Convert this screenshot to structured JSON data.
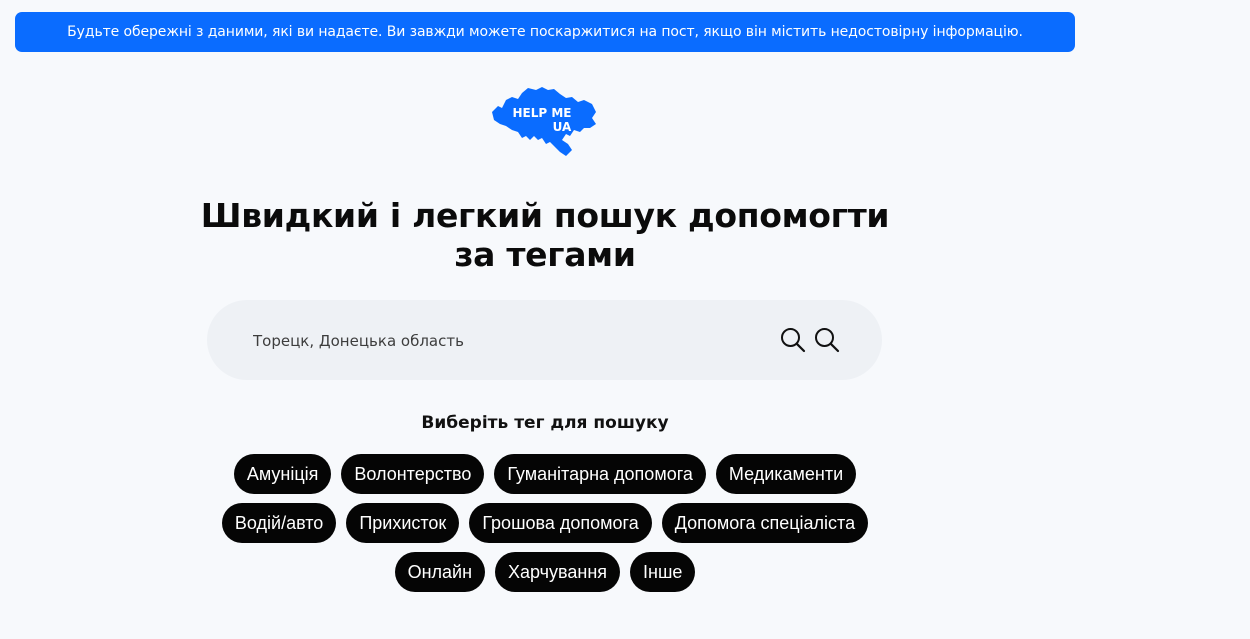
{
  "banner": {
    "text": "Будьте обережні з даними, які ви надаєте. Ви завжди можете поскаржитися на пост, якщо він містить недостовірну інформацію."
  },
  "logo": {
    "line1": "HELP ME",
    "line2": "UA",
    "color": "#0a6cff"
  },
  "headline": {
    "line1": "Швидкий і легкий пошук допомогти",
    "line2": "за тегами"
  },
  "search": {
    "value": "",
    "placeholder": "Торецк, Донецька область",
    "icons": [
      "search-icon",
      "search-icon"
    ]
  },
  "tags": {
    "title": "Виберіть тег для пошуку",
    "rows": [
      [
        "Амуніція",
        "Волонтерство",
        "Гуманітарна допомога",
        "Медикаменти"
      ],
      [
        "Водій/авто",
        "Прихисток",
        "Грошова допомога",
        "Допомога спеціаліста"
      ],
      [
        "Онлайн",
        "Харчування",
        "Інше"
      ]
    ]
  },
  "colors": {
    "accent": "#0a6cff",
    "background": "#f7f9fc",
    "tag_bg": "#050505",
    "search_bg": "#eef1f5"
  }
}
